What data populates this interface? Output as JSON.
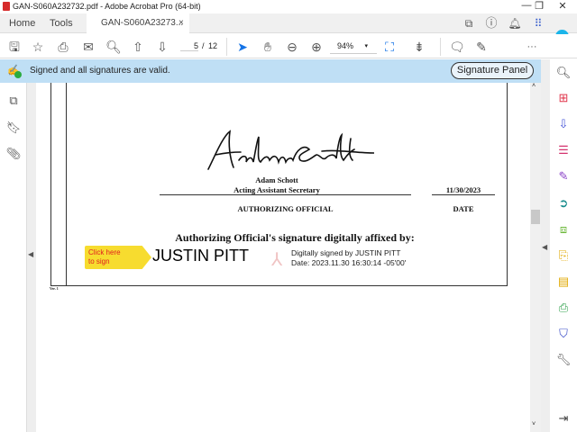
{
  "window": {
    "title": "GAN-S060A232732.pdf - Adobe Acrobat Pro (64-bit)",
    "minimize": "—",
    "restore": "❐",
    "close": "✕"
  },
  "tabs": {
    "home": "Home",
    "tools": "Tools",
    "document": "GAN-S060A23273...",
    "close": "×"
  },
  "toolbar": {
    "page_current": "5",
    "page_sep": "/",
    "page_total": "12",
    "zoom": "94%",
    "more": "···"
  },
  "sigbar": {
    "message": "Signed and all signatures are valid.",
    "button": "Signature Panel"
  },
  "document": {
    "signer_name": "Adam Schott",
    "signer_title": "Acting Assistant Secretary",
    "date": "11/30/2023",
    "official_label": "AUTHORIZING OFFICIAL",
    "date_label": "DATE",
    "affixed_heading": "Authorizing Official's signature digitally affixed by:",
    "sign_here_line1": "Click here",
    "sign_here_line2": "to sign",
    "digital_name": "JUSTIN PITT",
    "digital_line1": "Digitally signed by JUSTIN PITT",
    "digital_line2": "Date: 2023.11.30 16:30:14 -05'00'",
    "footer": "Ver. 1"
  },
  "colors": {
    "sigbar": "#bfdff5",
    "accent": "#1473e6",
    "sign_here": "#f7dc2f",
    "sign_here_text": "#e02020"
  }
}
